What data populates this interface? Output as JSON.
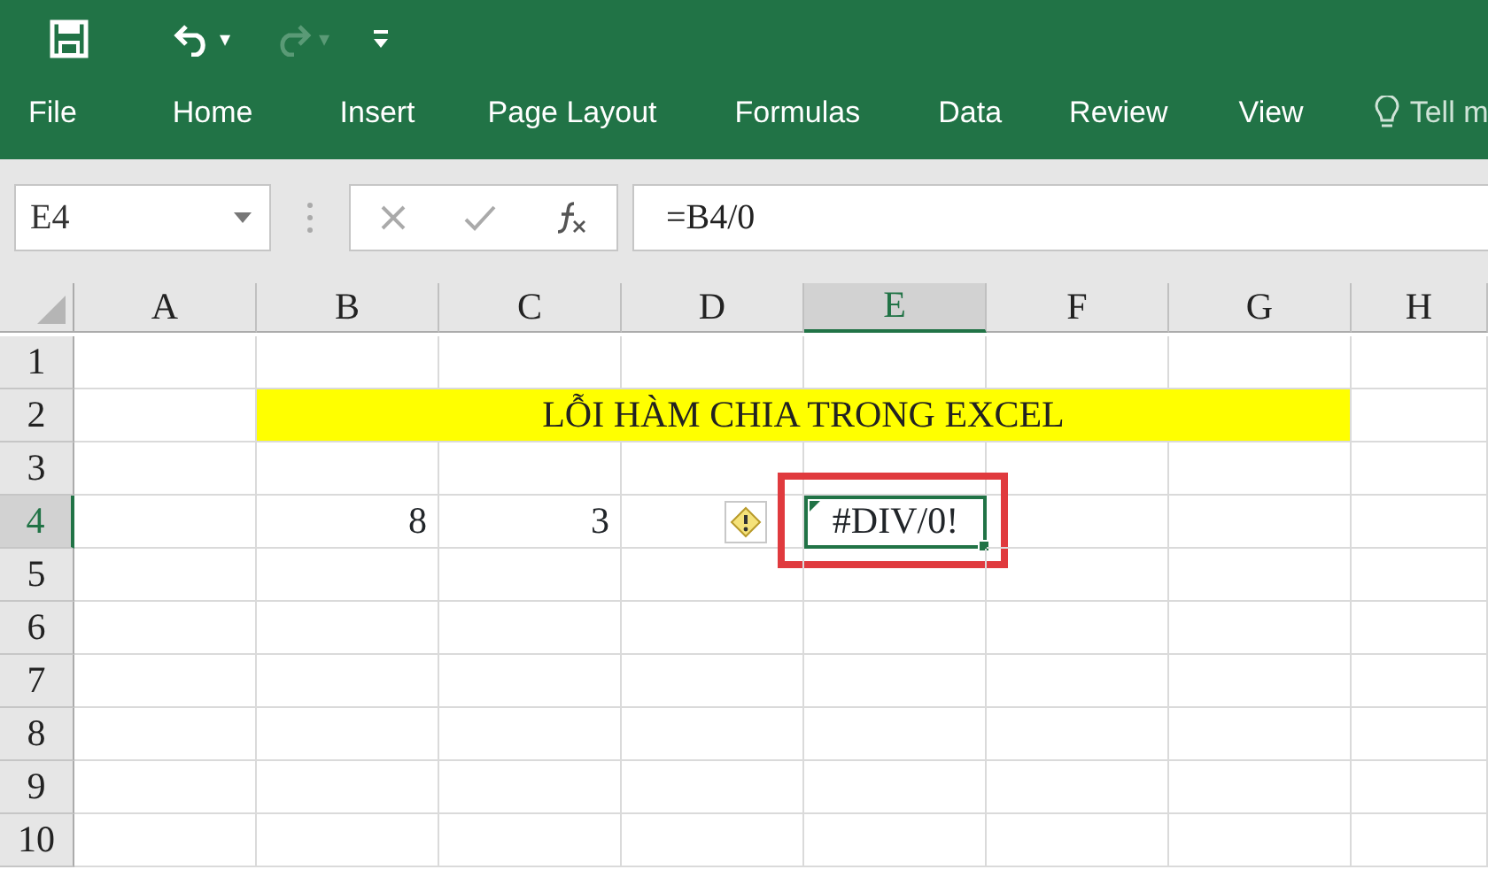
{
  "quick_access": {
    "undo_dropdown": "▾",
    "redo_dropdown": "▾"
  },
  "ribbon_tabs": [
    {
      "label": "File"
    },
    {
      "label": "Home"
    },
    {
      "label": "Insert"
    },
    {
      "label": "Page Layout"
    },
    {
      "label": "Formulas"
    },
    {
      "label": "Data"
    },
    {
      "label": "Review"
    },
    {
      "label": "View"
    }
  ],
  "tell_me": "Tell m",
  "formula_bar": {
    "name_box": "E4",
    "formula": "=B4/0"
  },
  "columns": [
    {
      "label": "A",
      "selected": false
    },
    {
      "label": "B",
      "selected": false
    },
    {
      "label": "C",
      "selected": false
    },
    {
      "label": "D",
      "selected": false
    },
    {
      "label": "E",
      "selected": true
    },
    {
      "label": "F",
      "selected": false
    },
    {
      "label": "G",
      "selected": false
    },
    {
      "label": "H",
      "selected": false
    }
  ],
  "rows": [
    {
      "label": "1",
      "selected": false
    },
    {
      "label": "2",
      "selected": false,
      "cells": [
        {
          "kind": "empty"
        },
        {
          "kind": "merged-title",
          "text": "LỖI HÀM CHIA TRONG EXCEL"
        }
      ]
    },
    {
      "label": "3",
      "selected": false
    },
    {
      "label": "4",
      "selected": true,
      "cells": [
        {
          "kind": "empty"
        },
        {
          "kind": "number",
          "text": "8"
        },
        {
          "kind": "number",
          "text": "3"
        },
        {
          "kind": "error-flag"
        },
        {
          "kind": "error",
          "text": "#DIV/0!",
          "selected": true,
          "annotated": true
        }
      ]
    },
    {
      "label": "5",
      "selected": false
    },
    {
      "label": "6",
      "selected": false
    },
    {
      "label": "7",
      "selected": false
    },
    {
      "label": "8",
      "selected": false
    },
    {
      "label": "9",
      "selected": false
    },
    {
      "label": "10",
      "selected": false
    }
  ]
}
